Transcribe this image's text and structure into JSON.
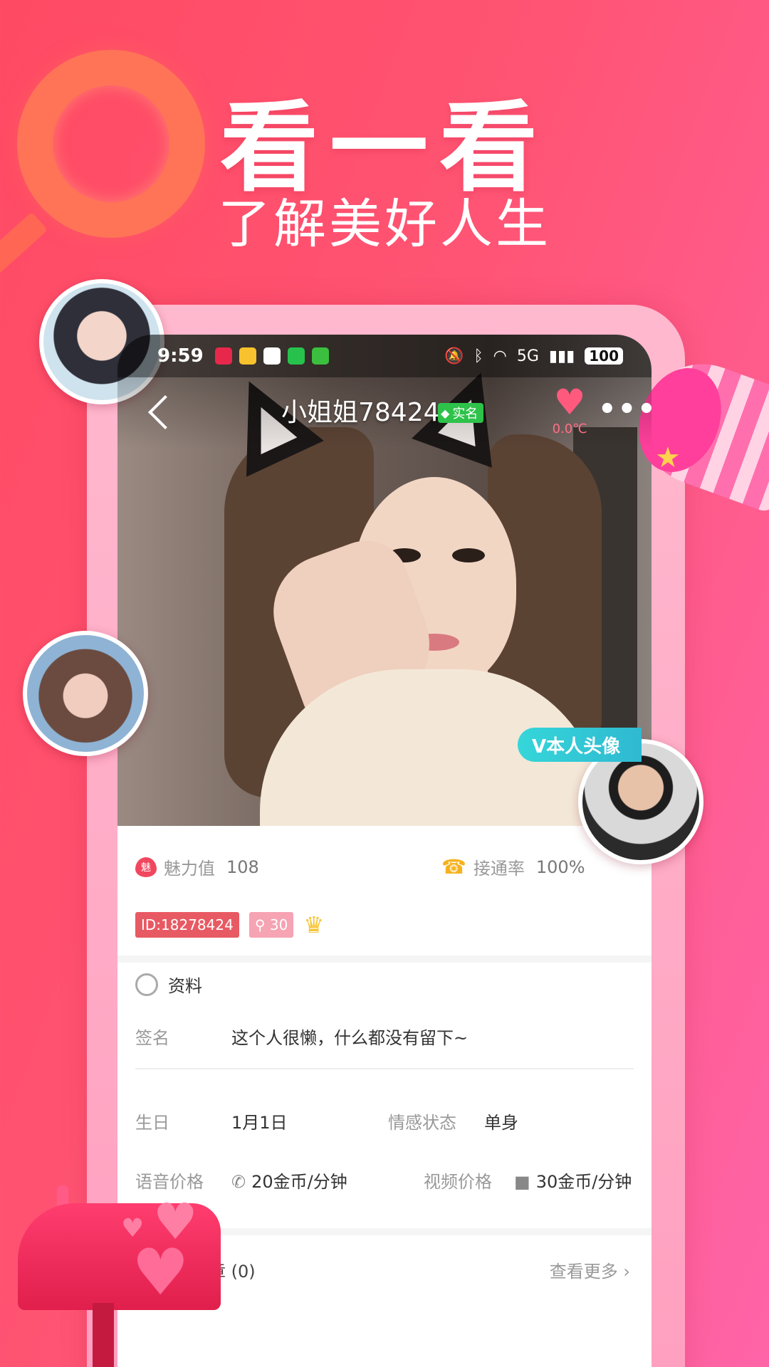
{
  "promo": {
    "title": "看一看",
    "subtitle": "了解美好人生"
  },
  "status_bar": {
    "time": "9:59",
    "signal": "5G",
    "battery": "100"
  },
  "profile": {
    "name": "小姐姐78424",
    "verified_label": "实名",
    "temperature": "0.0℃",
    "real_avatar_label": "V本人头像",
    "charm_label": "魅力值",
    "charm_value": "108",
    "answer_rate_label": "接通率",
    "answer_rate_value": "100%",
    "id_tag": "ID:18278424",
    "level_tag": "30",
    "section_title": "资料",
    "signature_label": "签名",
    "signature_value": "这个人很懒，什么都没有留下~",
    "birthday_label": "生日",
    "birthday_value": "1月1日",
    "relationship_label": "情感状态",
    "relationship_value": "单身",
    "voice_price_label": "语音价格",
    "voice_price_value": "20金币/分钟",
    "video_price_label": "视频价格",
    "video_price_value": "30金币/分钟",
    "honor_label": "耀勋章 (0)",
    "see_more_label": "查看更多"
  },
  "icons": {
    "back": "chevron-left-icon",
    "more": "more-dots-icon",
    "heart": "heart-icon",
    "phone": "phone-icon",
    "video": "video-icon",
    "crown": "crown-icon"
  },
  "colors": {
    "accent": "#ff5474",
    "verified": "#2ec24a",
    "id_tag": "#e85a63",
    "real_badge": "#35d6d9"
  }
}
